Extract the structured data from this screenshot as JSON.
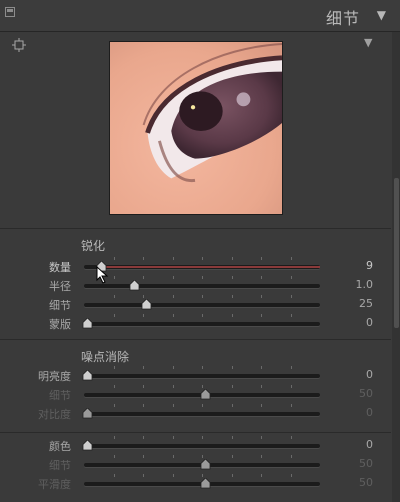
{
  "panel": {
    "title": "细节",
    "toggle_icon": "triangle-down-icon"
  },
  "preview": {
    "target_icon": "crosshair-target-icon",
    "menu_icon": "triangle-down-icon"
  },
  "sharpening": {
    "title": "锐化",
    "sliders": [
      {
        "label": "数量",
        "value": "9",
        "level": 0.06,
        "state": "active",
        "accent": "#8a3a3a"
      },
      {
        "label": "半径",
        "value": "1.0",
        "level": 0.2,
        "state": "normal"
      },
      {
        "label": "细节",
        "value": "25",
        "level": 0.25,
        "state": "normal"
      },
      {
        "label": "蒙版",
        "value": "0",
        "level": 0.0,
        "state": "normal"
      }
    ]
  },
  "noise": {
    "title": "噪点消除",
    "luminance_sliders": [
      {
        "label": "明亮度",
        "value": "0",
        "level": 0.0,
        "state": "normal"
      },
      {
        "label": "细节",
        "value": "50",
        "level": 0.5,
        "state": "dim"
      },
      {
        "label": "对比度",
        "value": "0",
        "level": 0.0,
        "state": "dim"
      }
    ],
    "color_sliders": [
      {
        "label": "颜色",
        "value": "0",
        "level": 0.0,
        "state": "normal"
      },
      {
        "label": "细节",
        "value": "50",
        "level": 0.5,
        "state": "dim"
      },
      {
        "label": "平滑度",
        "value": "50",
        "level": 0.5,
        "state": "dim"
      }
    ]
  },
  "colors": {
    "background": "#3a3a3a",
    "track": "#1b1b1b",
    "accent": "#8a3a3a"
  }
}
